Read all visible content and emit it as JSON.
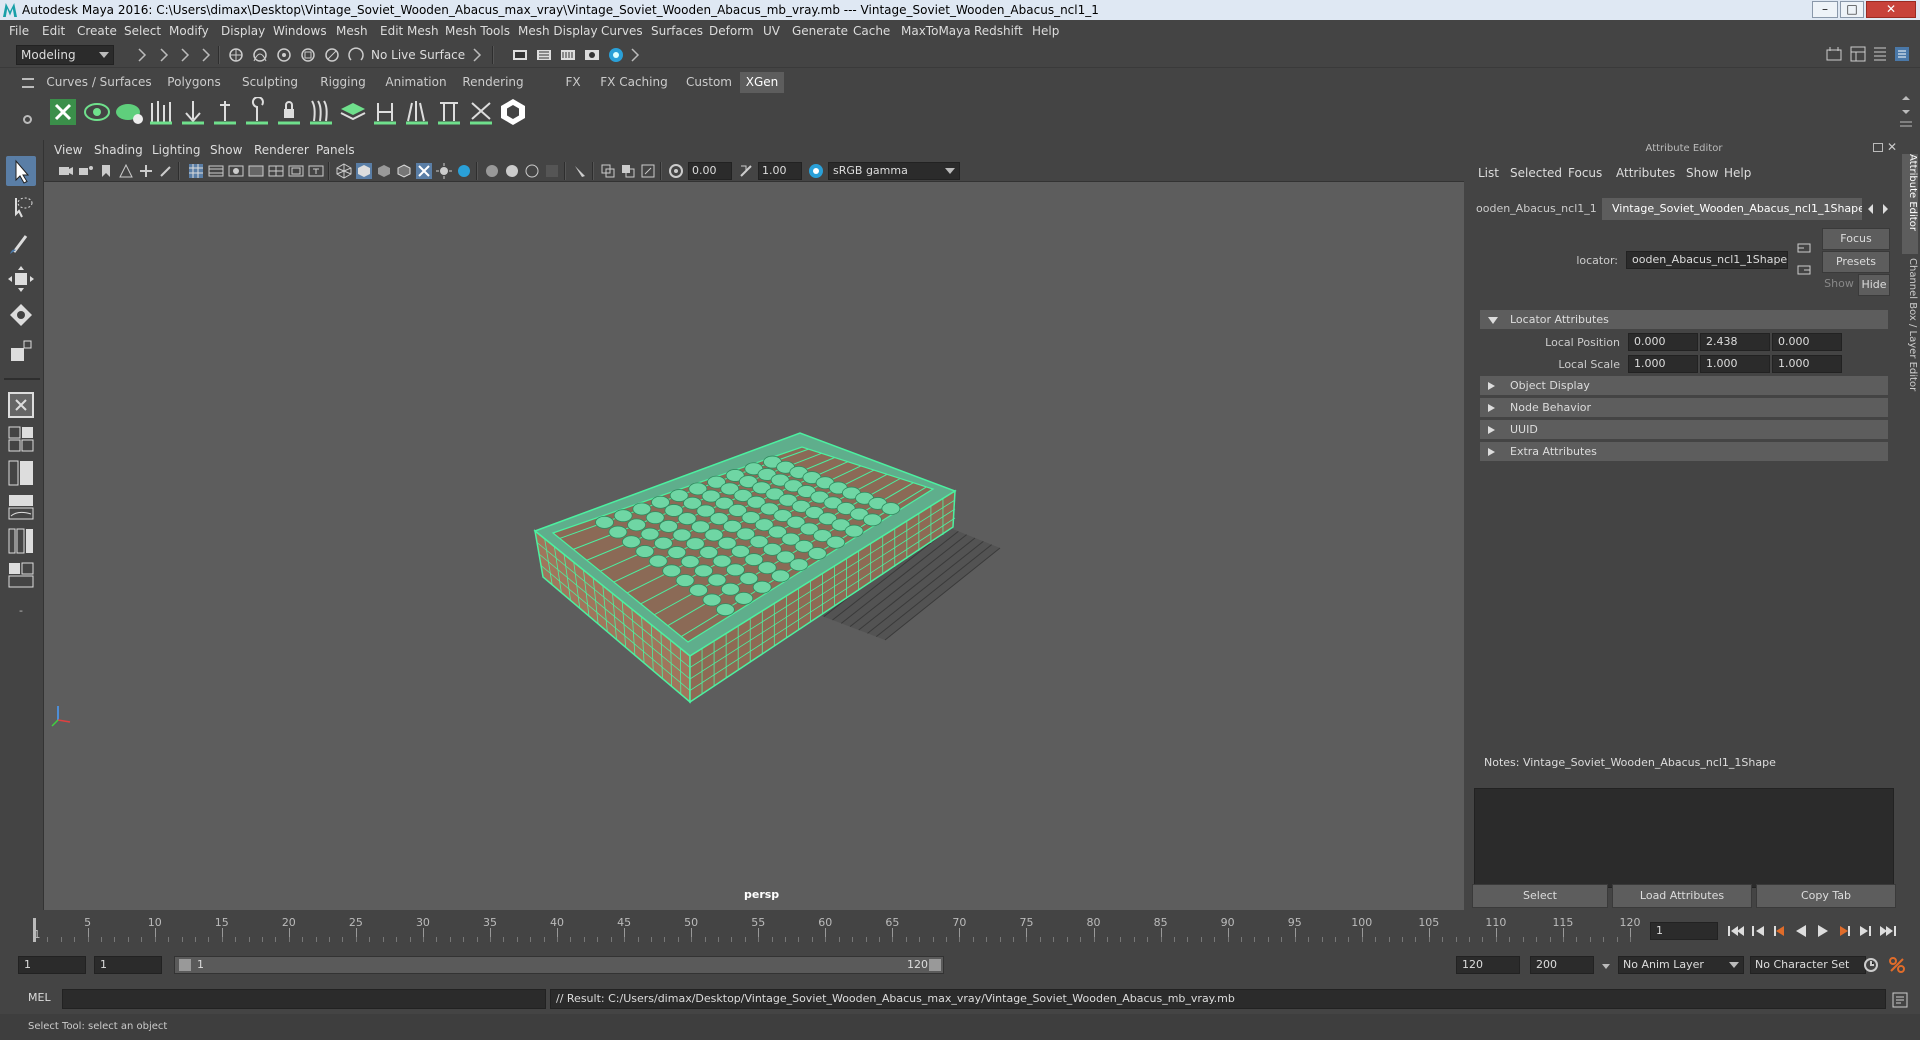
{
  "window": {
    "title": "Autodesk Maya 2016: C:\\Users\\dimax\\Desktop\\Vintage_Soviet_Wooden_Abacus_max_vray\\Vintage_Soviet_Wooden_Abacus_mb_vray.mb   ---   Vintage_Soviet_Wooden_Abacus_ncl1_1",
    "minimize": "–",
    "maximize": "□",
    "close": "✕"
  },
  "menubar": [
    "File",
    "Edit",
    "Create",
    "Select",
    "Modify",
    "Display",
    "Windows",
    "Mesh",
    "Edit Mesh",
    "Mesh Tools",
    "Mesh Display",
    "Curves",
    "Surfaces",
    "Deform",
    "UV",
    "Generate",
    "Cache",
    "MaxToMaya",
    "Redshift",
    "Help"
  ],
  "statusline": {
    "mode": "Modeling",
    "live_surface": "No Live Surface"
  },
  "shelf_tabs": [
    "Curves / Surfaces",
    "Polygons",
    "Sculpting",
    "Rigging",
    "Animation",
    "Rendering",
    "FX",
    "FX Caching",
    "Custom",
    "XGen"
  ],
  "shelf_active": "XGen",
  "viewport": {
    "menu": [
      "View",
      "Shading",
      "Lighting",
      "Show",
      "Renderer",
      "Panels"
    ],
    "exposure": "0.00",
    "gamma": "1.00",
    "colorspace": "sRGB gamma",
    "camera": "persp",
    "wire_color": "#4cf0a0",
    "wood_color": "#a0765c"
  },
  "attribute_editor": {
    "header": "Attribute Editor",
    "menu": [
      "List",
      "Selected",
      "Focus",
      "Attributes",
      "Show",
      "Help"
    ],
    "tabs": [
      "ooden_Abacus_ncl1_1",
      "Vintage_Soviet_Wooden_Abacus_ncl1_1Shape"
    ],
    "node_label": "locator:",
    "node_value": "ooden_Abacus_ncl1_1Shape",
    "focus": "Focus",
    "presets": "Presets",
    "show": "Show",
    "hide": "Hide",
    "sections": {
      "locator_attributes": "Locator Attributes",
      "object_display": "Object Display",
      "node_behavior": "Node Behavior",
      "uuid": "UUID",
      "extra_attributes": "Extra Attributes"
    },
    "local_position": {
      "label": "Local Position",
      "x": "0.000",
      "y": "2.438",
      "z": "0.000"
    },
    "local_scale": {
      "label": "Local Scale",
      "x": "1.000",
      "y": "1.000",
      "z": "1.000"
    },
    "notes": "Notes:  Vintage_Soviet_Wooden_Abacus_ncl1_1Shape",
    "buttons": {
      "select": "Select",
      "load": "Load Attributes",
      "copy": "Copy Tab"
    }
  },
  "side_tabs": [
    "Attribute Editor",
    "Channel Box / Layer Editor"
  ],
  "timeline": {
    "ticks": [
      1,
      5,
      10,
      15,
      20,
      25,
      30,
      35,
      40,
      45,
      50,
      55,
      60,
      65,
      70,
      75,
      80,
      85,
      90,
      95,
      100,
      105,
      110,
      115,
      120
    ],
    "current": "1",
    "start": 1,
    "end": 120
  },
  "range": {
    "start": "1",
    "playback_start": "1",
    "slider_start": "1",
    "slider_end": "120",
    "playback_end": "120",
    "end": "200",
    "anim_layer": "No Anim Layer",
    "char_set": "No Character Set"
  },
  "cmdline": {
    "lang": "MEL",
    "result": "// Result: C:/Users/dimax/Desktop/Vintage_Soviet_Wooden_Abacus_max_vray/Vintage_Soviet_Wooden_Abacus_mb_vray.mb"
  },
  "help": "Select Tool: select an object"
}
